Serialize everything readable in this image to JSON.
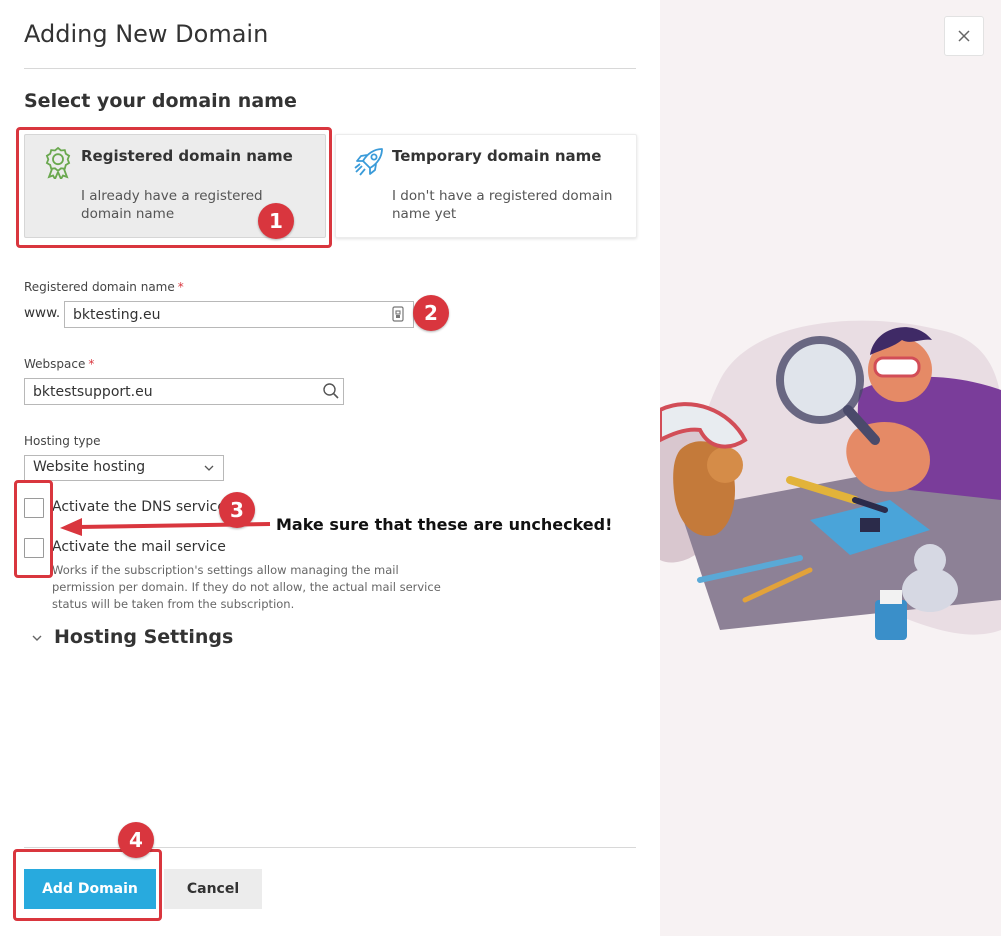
{
  "dialog": {
    "title": "Adding New Domain",
    "section_title": "Select your domain name",
    "close_label": "×"
  },
  "options": [
    {
      "title": "Registered domain name",
      "desc": "I already have a registered domain name",
      "selected": true,
      "icon": "award-icon"
    },
    {
      "title": "Temporary domain name",
      "desc": "I don't have a registered domain name yet",
      "selected": false,
      "icon": "rocket-icon"
    }
  ],
  "fields": {
    "domain_label": "Registered domain name",
    "required_mark": "*",
    "domain_prefix": "www.",
    "domain_value": "bktesting.eu",
    "webspace_label": "Webspace",
    "webspace_value": "bktestsupport.eu",
    "hosting_type_label": "Hosting type",
    "hosting_type_value": "Website hosting"
  },
  "checkboxes": [
    {
      "label": "Activate the DNS service",
      "checked": false
    },
    {
      "label": "Activate the mail service",
      "checked": false
    }
  ],
  "mail_hint": "Works if the subscription's settings allow managing the mail permission per domain. If they do not allow, the actual mail service status will be taken from the subscription.",
  "hosting_settings": {
    "label": "Hosting Settings"
  },
  "buttons": {
    "add": "Add Domain",
    "cancel": "Cancel"
  },
  "annotations": {
    "badges": [
      "1",
      "2",
      "3",
      "4"
    ],
    "note": "Make sure that these are unchecked!",
    "color": "#d9363e"
  },
  "colors": {
    "primary": "#28aade",
    "accent_green": "#6aa84f",
    "accent_blue": "#3a9bd9"
  }
}
